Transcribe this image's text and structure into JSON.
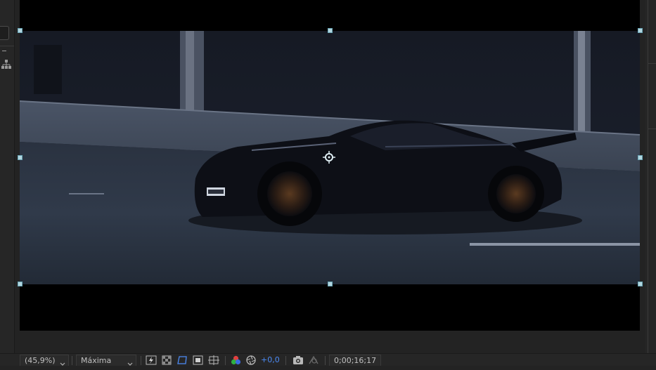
{
  "viewer": {
    "scene": "night-car-footage",
    "colors": {
      "background": "#000000",
      "handle": "#b3d6e0",
      "accent": "#4c8bf5"
    }
  },
  "toolbar": {
    "magnification": "(45,9%)",
    "resolution": "Máxima",
    "exposure_value": "+0,0",
    "timecode": "0;00;16;17",
    "icons": [
      "fast-previews-icon",
      "transparency-grid-icon",
      "region-of-interest-icon",
      "mask-visibility-icon",
      "guides-grid-icon",
      "color-channels-icon",
      "exposure-reset-icon",
      "snapshot-icon",
      "show-snapshot-icon"
    ]
  },
  "left_panel": {
    "icons": [
      "flowchart-icon"
    ]
  }
}
